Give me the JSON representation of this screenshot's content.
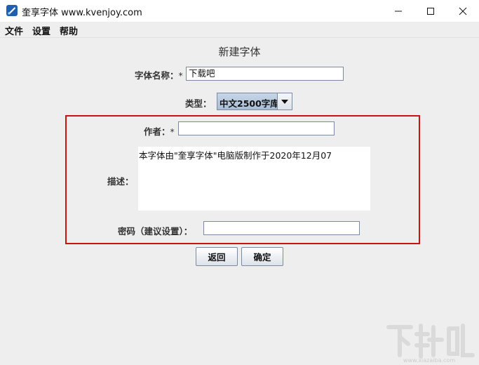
{
  "window": {
    "title": "奎享字体 www.kvenjoy.com",
    "controls": [
      "minimize-icon",
      "maximize-icon",
      "close-icon"
    ]
  },
  "menu": {
    "items": [
      "文件",
      "设置",
      "帮助"
    ]
  },
  "form": {
    "title": "新建字体",
    "font_name_label": "字体名称：",
    "font_name_value": "下载吧",
    "type_label": "类型：",
    "type_value": "中文2500字库",
    "author_label": "作者：",
    "author_value": "",
    "required_mark": "*",
    "description_label": "描述：",
    "description_value": "本字体由\"奎享字体\"电脑版制作于2020年12月07",
    "password_label": "密码（建议设置）：",
    "password_value": ""
  },
  "buttons": {
    "back": "返回",
    "confirm": "确定"
  },
  "colors": {
    "highlight_frame": "#cc1111",
    "combo_bg": "#b8cbe0",
    "window_bg": "#eeeeee"
  },
  "icons": {
    "app": "app-logo-icon",
    "combo_arrow": "chevron-down-icon"
  }
}
